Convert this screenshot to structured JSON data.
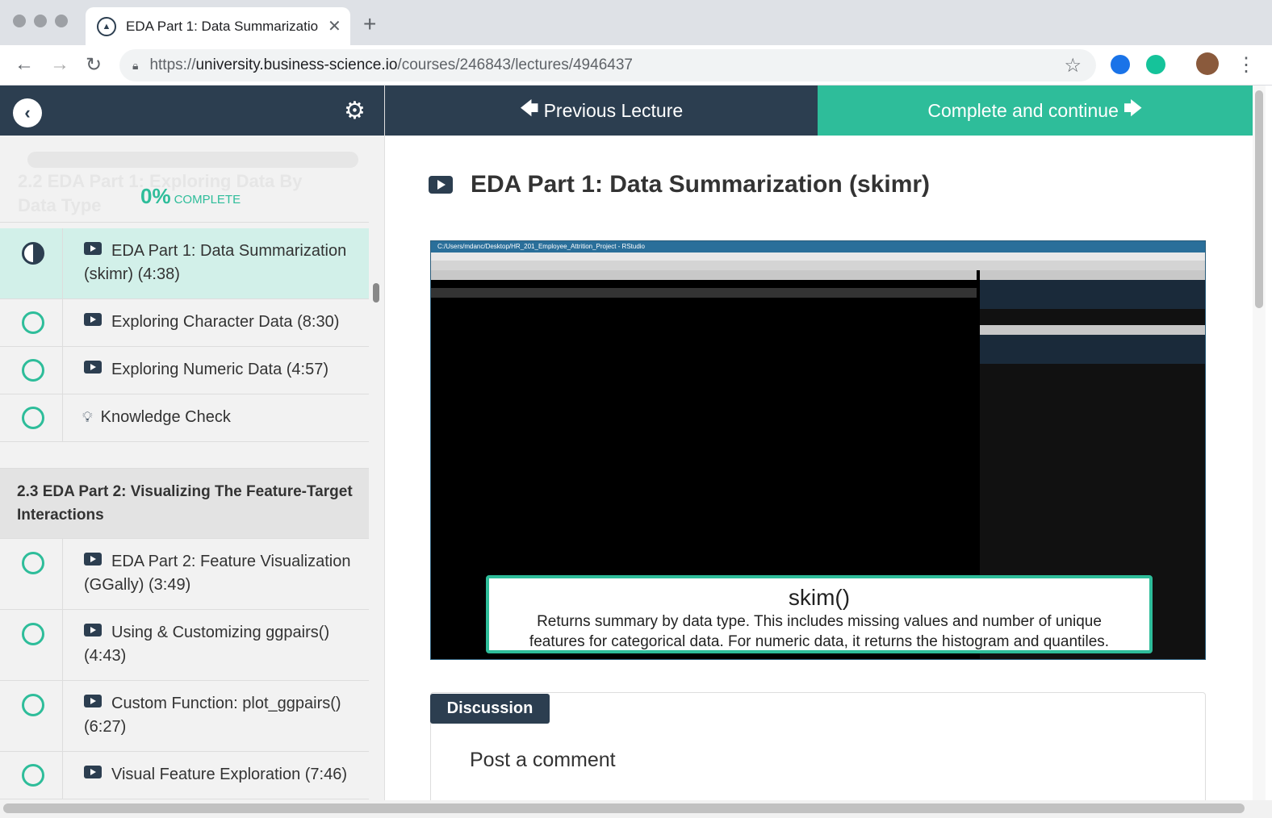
{
  "browser": {
    "tab_title": "EDA Part 1: Data Summarizatio",
    "url_prefix": "https://",
    "url_host": "university.business-science.io",
    "url_path": "/courses/246843/lectures/4946437"
  },
  "sidebar": {
    "progress_percent": "0%",
    "progress_label": "COMPLETE",
    "ghost_section": "2.2 EDA Part 1: Exploring Data By Data Type",
    "items_a": [
      {
        "label": "EDA Part 1: Data Summarization (skimr) (4:38)",
        "status": "in-progress",
        "type": "video"
      },
      {
        "label": "Exploring Character Data (8:30)",
        "status": "incomplete",
        "type": "video"
      },
      {
        "label": "Exploring Numeric Data (4:57)",
        "status": "incomplete",
        "type": "video"
      },
      {
        "label": "Knowledge Check",
        "status": "incomplete",
        "type": "quiz"
      }
    ],
    "section_b_title": "2.3 EDA Part 2: Visualizing The Feature-Target Interactions",
    "items_b": [
      {
        "label": "EDA Part 2: Feature Visualization (GGally) (3:49)",
        "status": "incomplete",
        "type": "video"
      },
      {
        "label": "Using & Customizing ggpairs() (4:43)",
        "status": "incomplete",
        "type": "video"
      },
      {
        "label": "Custom Function: plot_ggpairs() (6:27)",
        "status": "incomplete",
        "type": "video"
      },
      {
        "label": "Visual Feature Exploration (7:46)",
        "status": "incomplete",
        "type": "video"
      }
    ]
  },
  "nav": {
    "previous_label": "Previous Lecture",
    "complete_label": "Complete and continue"
  },
  "lecture": {
    "title": "EDA Part 1: Data Summarization (skimr)",
    "video": {
      "window_title": "C:/Users/mdanc/Desktop/HR_201_Employee_Attrition_Project - RStudio",
      "callout_title": "skim()",
      "callout_body_1": "Returns summary by data type. This includes missing values and number of unique",
      "callout_body_2": "features for categorical data. For numeric data, it returns the histogram and quantiles."
    }
  },
  "discussion": {
    "tab_label": "Discussion",
    "post_label": "Post a comment"
  },
  "colors": {
    "navy": "#2c3e50",
    "teal": "#2ebd9a"
  }
}
